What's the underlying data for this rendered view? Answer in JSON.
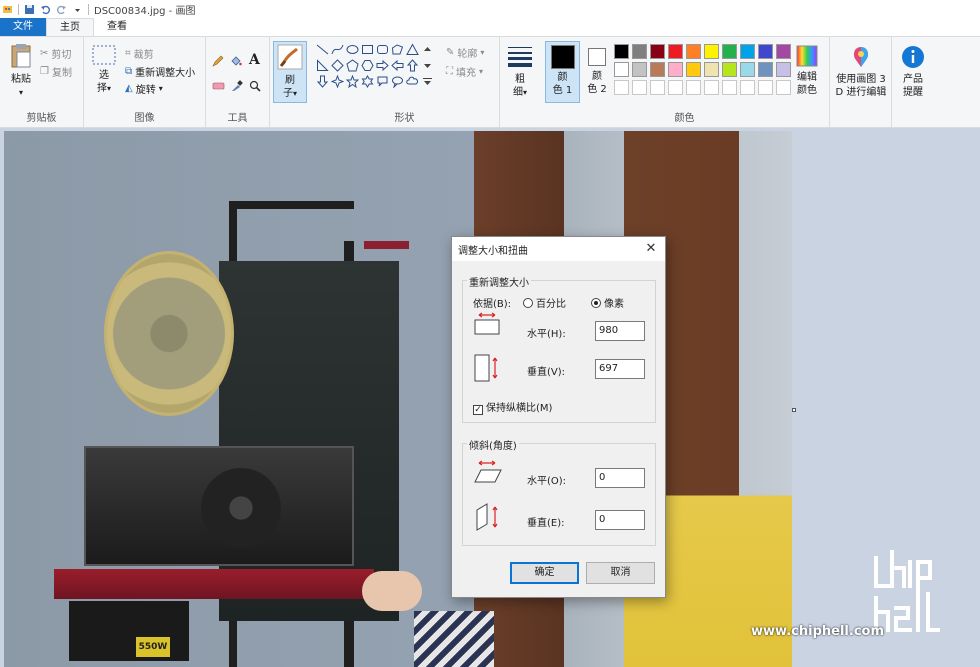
{
  "window": {
    "title": "DSC00834.jpg - 画图"
  },
  "tabs": [
    {
      "label": "文件"
    },
    {
      "label": "主页"
    },
    {
      "label": "查看"
    }
  ],
  "clipboard": {
    "paste": "粘贴",
    "cut": "剪切",
    "copy": "复制",
    "label": "剪贴板"
  },
  "image": {
    "select_line1": "选",
    "select_line2": "择",
    "crop": "裁剪",
    "resize": "重新调整大小",
    "rotate": "旋转",
    "label": "图像"
  },
  "tools": {
    "label": "工具"
  },
  "brushes": {
    "line1": "刷",
    "line2": "子"
  },
  "shapes": {
    "outline": "轮廓",
    "fill": "填充",
    "label": "形状"
  },
  "size": {
    "line1": "粗",
    "line2": "细"
  },
  "colors": {
    "color1_line1": "颜",
    "color1_line2": "色 1",
    "color2_line1": "颜",
    "color2_line2": "色 2",
    "edit_line1": "编辑",
    "edit_line2": "颜色",
    "label": "颜色",
    "color1": "#000000",
    "color2": "#ffffff",
    "palette_row1": [
      "#000000",
      "#7f7f7f",
      "#880015",
      "#ed1c24",
      "#ff7f27",
      "#fff200",
      "#22b14c",
      "#00a2e8",
      "#3f48cc",
      "#a349a4"
    ],
    "palette_row2": [
      "#ffffff",
      "#c3c3c3",
      "#b97a57",
      "#ffaec9",
      "#ffc90e",
      "#efe4b0",
      "#b5e61d",
      "#99d9ea",
      "#7092be",
      "#c8bfe7"
    ]
  },
  "paint3d": {
    "line1": "使用画图 3",
    "line2": "D 进行编辑"
  },
  "product": {
    "line1": "产品",
    "line2": "提醒"
  },
  "dialog": {
    "title": "调整大小和扭曲",
    "resize_legend": "重新调整大小",
    "by_label": "依据(B):",
    "percent": "百分比",
    "pixels": "像素",
    "horizontal_label": "水平(H):",
    "horizontal_value": "980",
    "vertical_label": "垂直(V):",
    "vertical_value": "697",
    "keep_ratio": "保持纵横比(M)",
    "skew_legend": "倾斜(角度)",
    "skew_h_label": "水平(O):",
    "skew_h_value": "0",
    "skew_v_label": "垂直(E):",
    "skew_v_value": "0",
    "ok": "确定",
    "cancel": "取消"
  },
  "canvas": {
    "psu_label": "550W",
    "watermark": "www.chiphell.com"
  }
}
